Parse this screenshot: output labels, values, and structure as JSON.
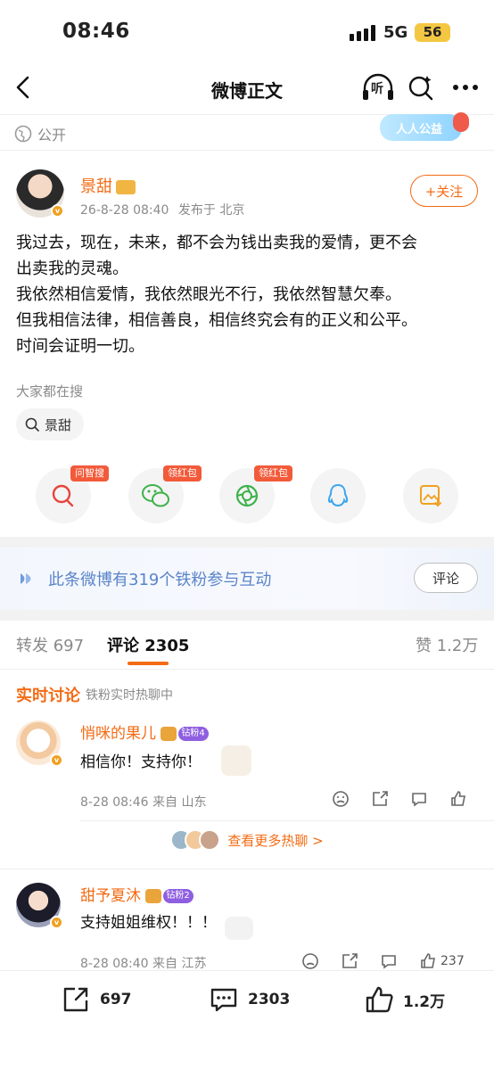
{
  "status": {
    "time": "08:46",
    "network": "5G",
    "battery": "56"
  },
  "nav": {
    "title": "微博正文",
    "listen": "听"
  },
  "visibility": {
    "label": "公开",
    "charity_badge": "人人公益"
  },
  "post": {
    "author": "景甜",
    "time": "26-8-28 08:40",
    "location": "发布于 北京",
    "follow_label": "+关注",
    "lines": [
      "我过去，现在，未来，都不会为钱出卖我的爱情，更不会",
      "出卖我的灵魂。",
      "我依然相信爱情，我依然眼光不行，我依然智慧欠奉。",
      "但我相信法律，相信善良，相信终究会有的正义和公平。",
      "时间会证明一切。"
    ],
    "search_label": "大家都在搜",
    "search_chip": "景甜"
  },
  "share": {
    "badges": [
      "问智搜",
      "领红包",
      "领红包"
    ],
    "icons": [
      "wen-search-icon",
      "wechat-icon",
      "moments-icon",
      "qq-icon",
      "save-image-icon"
    ]
  },
  "fans": {
    "text": "此条微博有319个铁粉参与互动",
    "button": "评论"
  },
  "tabs": {
    "repost": "转发 697",
    "comments": "评论 2305",
    "likes": "赞 1.2万"
  },
  "realtime": {
    "title": "实时讨论",
    "subtitle": "铁粉实时热聊中"
  },
  "comments": [
    {
      "name": "悄咪的果儿",
      "fan_level": "钻粉4",
      "text": "相信你！支持你！",
      "meta": "8-28 08:46 来自 山东",
      "likes": ""
    },
    {
      "name": "甜予夏沐",
      "fan_level": "钻粉2",
      "text": "支持姐姐维权！！！",
      "meta": "8-28 08:40 来自 江苏",
      "likes": "237"
    }
  ],
  "more_hot": "查看更多热聊 >",
  "bottom": {
    "repost": "697",
    "comments": "2303",
    "likes": "1.2万"
  },
  "colors": {
    "accent": "#f36b14",
    "fan_blue": "#5a84c9"
  }
}
